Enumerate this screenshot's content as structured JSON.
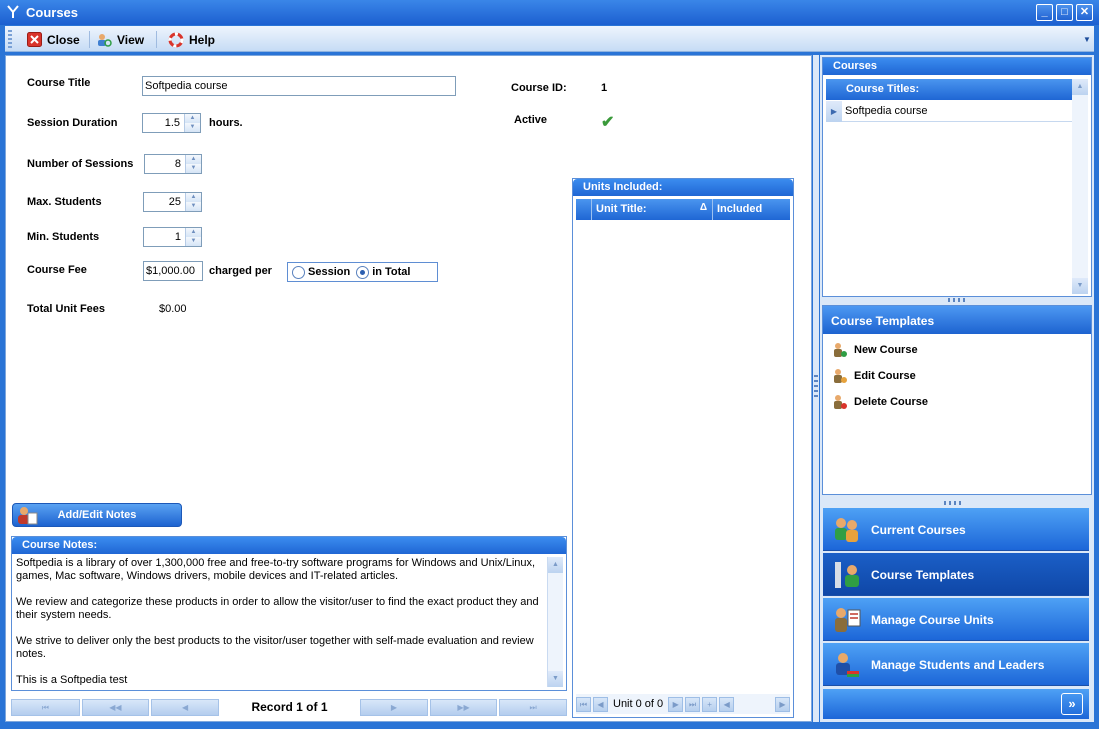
{
  "window": {
    "title": "Courses",
    "buttons": {
      "minimize": "_",
      "maximize": "□",
      "close": "✕"
    }
  },
  "toolbar": {
    "close_label": "Close",
    "view_label": "View",
    "help_label": "Help"
  },
  "form": {
    "course_title_label": "Course Title",
    "course_title_value": "Softpedia course",
    "course_id_label": "Course ID:",
    "course_id_value": "1",
    "active_label": "Active",
    "session_duration_label": "Session Duration",
    "session_duration_value": "1.5",
    "hours_label": "hours.",
    "num_sessions_label": "Number of Sessions",
    "num_sessions_value": "8",
    "max_students_label": "Max. Students",
    "max_students_value": "25",
    "min_students_label": "Min. Students",
    "min_students_value": "1",
    "course_fee_label": "Course Fee",
    "course_fee_value": "$1,000.00",
    "charged_per_label": "charged per",
    "radio_session_label": "Session",
    "radio_total_label": "in Total",
    "total_unit_fees_label": "Total Unit Fees",
    "total_unit_fees_value": "$0.00"
  },
  "units": {
    "title": "Units Included:",
    "columns": [
      "Unit Title:",
      "Included"
    ],
    "sort_glyph": "Δ",
    "footer_text": "Unit 0 of 0"
  },
  "notes": {
    "button_label": "Add/Edit Notes",
    "title": "Course Notes:",
    "paragraphs": [
      "Softpedia is a library of over 1,300,000 free and free-to-try software programs for Windows and Unix/Linux, games, Mac software, Windows drivers, mobile devices and IT-related articles.",
      "We review and categorize these products in order to allow the visitor/user to find the exact product they and their system needs.",
      "We strive to deliver only the best products to the visitor/user together with self-made evaluation and review notes.",
      "This is a Softpedia test"
    ]
  },
  "record_nav": {
    "text": "Record 1 of 1"
  },
  "right": {
    "courses_title": "Courses",
    "course_titles_header": "Course Titles:",
    "course_rows": [
      "Softpedia course"
    ],
    "templates_title": "Course Templates",
    "template_actions": [
      "New Course",
      "Edit Course",
      "Delete Course"
    ],
    "nav_buttons": [
      "Current Courses",
      "Course Templates",
      "Manage Course Units",
      "Manage Students and Leaders"
    ],
    "active_nav": "Course Templates"
  },
  "colors": {
    "accent": "#1f66d4",
    "window_bg": "#2a74d6",
    "panel_bg": "#dbe8f8",
    "check": "#3a9a3a"
  }
}
